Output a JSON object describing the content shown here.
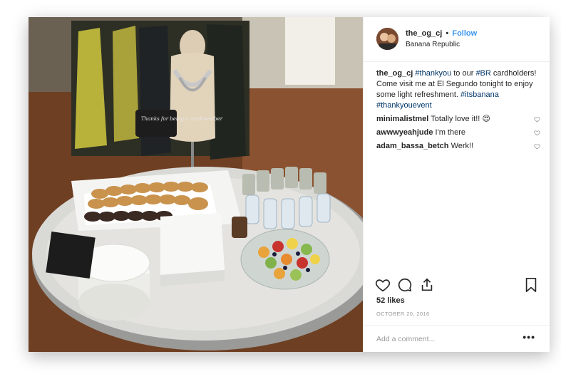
{
  "post": {
    "username": "the_og_cj",
    "follow_label": "Follow",
    "location": "Banana Republic",
    "caption": {
      "username": "the_og_cj",
      "tag1": "#thankyou",
      "text1": " to our ",
      "tag2": "#BR",
      "text2": " cardholders! Come visit me at El Segundo tonight to enjoy some light refreshment. ",
      "tag3": "#itsbanana",
      "tag4": "#thankyouevent"
    },
    "comments": [
      {
        "username": "minimalistmel",
        "text": "Totally love it!! 😍"
      },
      {
        "username": "awwwyeahjude",
        "text": "I'm there"
      },
      {
        "username": "adam_bassa_betch",
        "text": "Werk!!"
      }
    ],
    "likes": "52 likes",
    "date": "OCTOBER 20, 2016",
    "add_comment_placeholder": "Add a comment...",
    "more_label": "•••"
  },
  "photo": {
    "sign_text": "Thanks for being a cardmember"
  },
  "icons": {
    "like": "heart-icon",
    "comment": "comment-icon",
    "share": "share-icon",
    "save": "bookmark-icon"
  },
  "colors": {
    "link": "#3897f0",
    "hashtag": "#003569",
    "muted": "#999999",
    "text": "#262626"
  }
}
